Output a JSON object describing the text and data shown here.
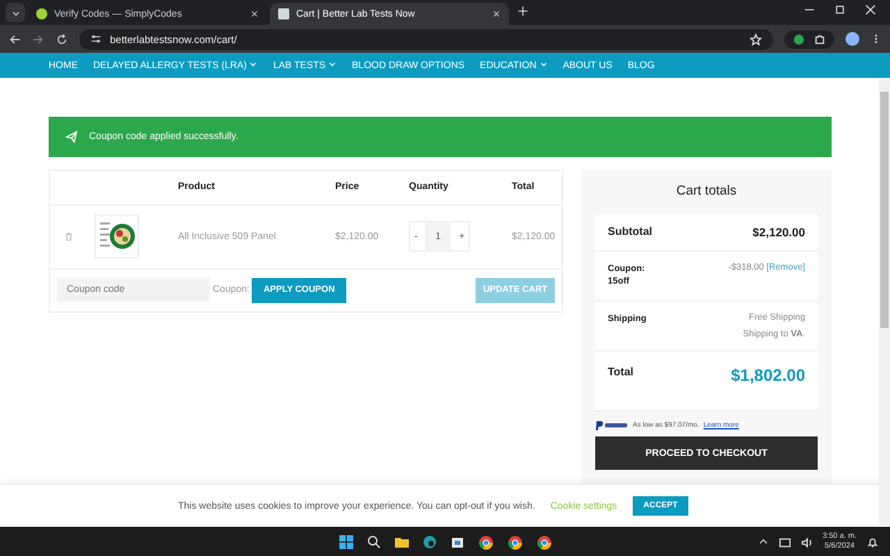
{
  "browser": {
    "tabs": [
      {
        "title": "Verify Codes — SimplyCodes",
        "selected": false
      },
      {
        "title": "Cart | Better Lab Tests Now",
        "selected": true
      }
    ],
    "url": "betterlabtestsnow.com/cart/"
  },
  "nav": {
    "items": [
      {
        "label": "HOME",
        "has_dropdown": false
      },
      {
        "label": "DELAYED ALLERGY TESTS (LRA)",
        "has_dropdown": true
      },
      {
        "label": "LAB TESTS",
        "has_dropdown": true
      },
      {
        "label": "BLOOD DRAW OPTIONS",
        "has_dropdown": false
      },
      {
        "label": "EDUCATION",
        "has_dropdown": true
      },
      {
        "label": "ABOUT US",
        "has_dropdown": false
      },
      {
        "label": "BLOG",
        "has_dropdown": false
      }
    ]
  },
  "notice": {
    "text": "Coupon code applied successfully."
  },
  "cart": {
    "columns": [
      "Product",
      "Price",
      "Quantity",
      "Total"
    ],
    "rows": [
      {
        "product": "All Inclusive 509 Panel",
        "price": "$2,120.00",
        "quantity": "1",
        "total": "$2,120.00"
      }
    ],
    "quantity_minus": "-",
    "quantity_plus": "+",
    "coupon_placeholder": "Coupon code",
    "coupon_label": "Coupon:",
    "apply_button": "APPLY COUPON",
    "update_button": {
      "label": "UPDATE CART",
      "disabled": true
    }
  },
  "totals": {
    "title": "Cart totals",
    "subtotal_label": "Subtotal",
    "subtotal": "$2,120.00",
    "coupon_label": "Coupon: 15off",
    "coupon_discount": "-$318.00",
    "remove_link": "[Remove]",
    "shipping_label": "Shipping",
    "shipping_method": "Free Shipping",
    "shipping_to": "Shipping to **VA**.",
    "total_label": "Total",
    "total": "$1,802.00",
    "paypal_text": "As low as $97.07/mo.",
    "paypal_link": "Learn more",
    "checkout_button": "PROCEED TO CHECKOUT"
  },
  "cookie_bar": {
    "text": "This website uses cookies to improve your experience. You can opt-out if you wish.",
    "settings_link": "Cookie settings",
    "accept_button": "ACCEPT"
  },
  "taskbar": {
    "time": "3:50 a. m.",
    "date": "5/6/2024"
  }
}
